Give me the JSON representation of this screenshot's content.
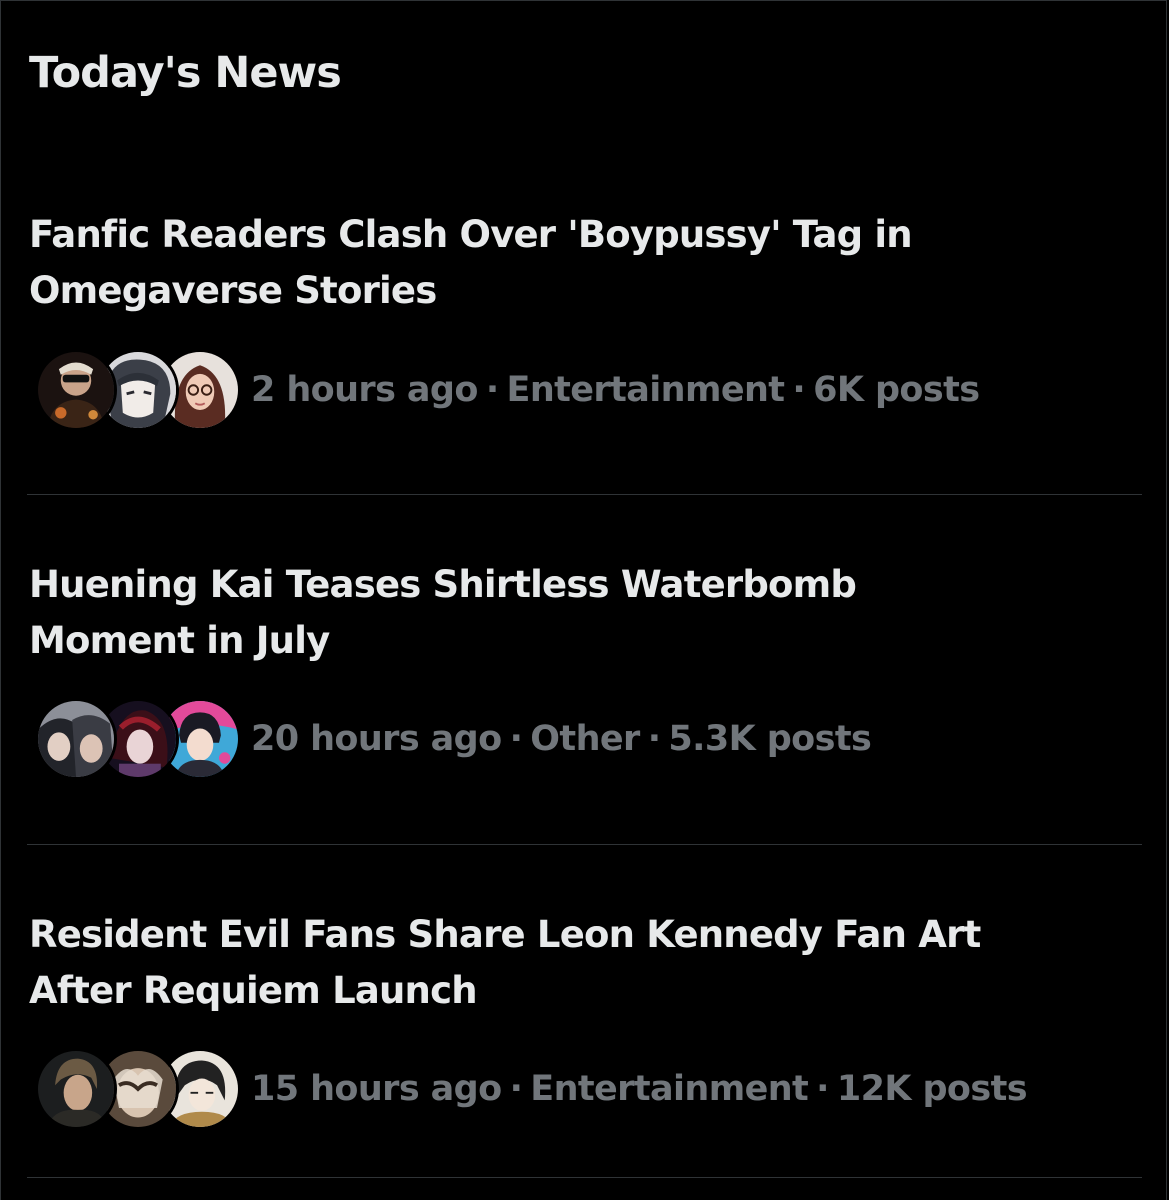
{
  "section": {
    "title": "Today's News"
  },
  "news": [
    {
      "headline_line1": "Fanfic Readers Clash Over 'Boypussy' Tag in",
      "headline_line2": "Omegaverse Stories",
      "time": "2 hours ago",
      "category": "Entertainment",
      "posts": "6K posts",
      "separator": "·"
    },
    {
      "headline_line1": "Huening Kai Teases Shirtless Waterbomb",
      "headline_line2": "Moment in July",
      "time": "20 hours ago",
      "category": "Other",
      "posts": "5.3K posts",
      "separator": "·"
    },
    {
      "headline_line1": "Resident Evil Fans Share Leon Kennedy Fan Art",
      "headline_line2": "After Requiem Launch",
      "time": "15 hours ago",
      "category": "Entertainment",
      "posts": "12K posts",
      "separator": "·"
    }
  ],
  "colors": {
    "background": "#000000",
    "headline": "#e7e9ea",
    "meta": "#71767b",
    "divider": "#2f3336"
  },
  "icons": {
    "avatar": "avatar-icon"
  }
}
